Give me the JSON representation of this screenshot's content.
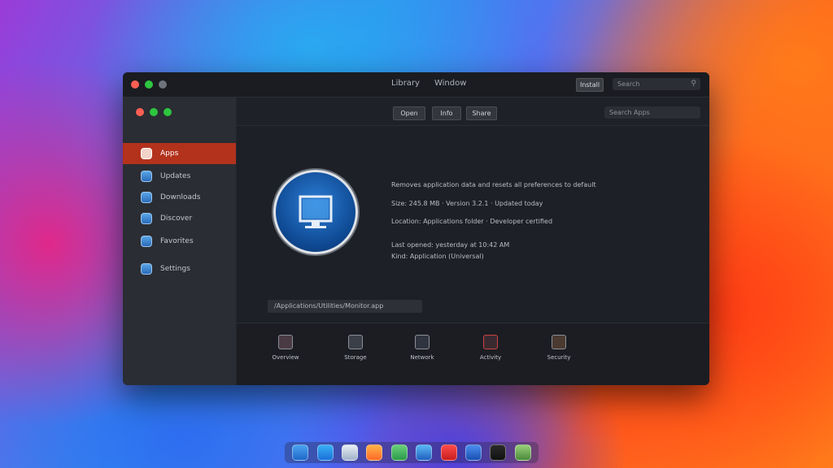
{
  "window": {
    "title_tabs": [
      "Library",
      "Window"
    ],
    "title_button": "Install",
    "title_search_placeholder": "Search"
  },
  "sidebar": {
    "items": [
      {
        "label": "Apps",
        "active": true
      },
      {
        "label": "Updates",
        "active": false
      },
      {
        "label": "Downloads",
        "active": false
      },
      {
        "label": "Discover",
        "active": false
      },
      {
        "label": "Favorites",
        "active": false
      },
      {
        "label": "Settings",
        "active": false
      }
    ]
  },
  "toolbar": {
    "buttons": [
      "Open",
      "Info",
      "Share"
    ],
    "search_placeholder": "Search Apps"
  },
  "detail": {
    "lines": [
      "Removes application data and resets all preferences to default",
      "Size: 245.8 MB · Version 3.2.1 · Updated today",
      "Location: Applications folder · Developer certified",
      "Last opened: yesterday at 10:42 AM",
      "Kind: Application (Universal)"
    ],
    "path": "/Applications/Utilities/Monitor.app"
  },
  "bottom": {
    "items": [
      "Overview",
      "Storage",
      "Network",
      "Activity",
      "Security"
    ]
  },
  "colors": {
    "accent": "#b3321c",
    "window_bg": "#1d2026",
    "sidebar_bg": "#2a2d33"
  },
  "dock": {
    "icons": [
      "finder-icon",
      "appstore-icon",
      "calendar-icon",
      "photos-icon",
      "maps-icon",
      "safari-icon",
      "news-icon",
      "mail-icon",
      "terminal-icon",
      "preview-icon"
    ]
  }
}
